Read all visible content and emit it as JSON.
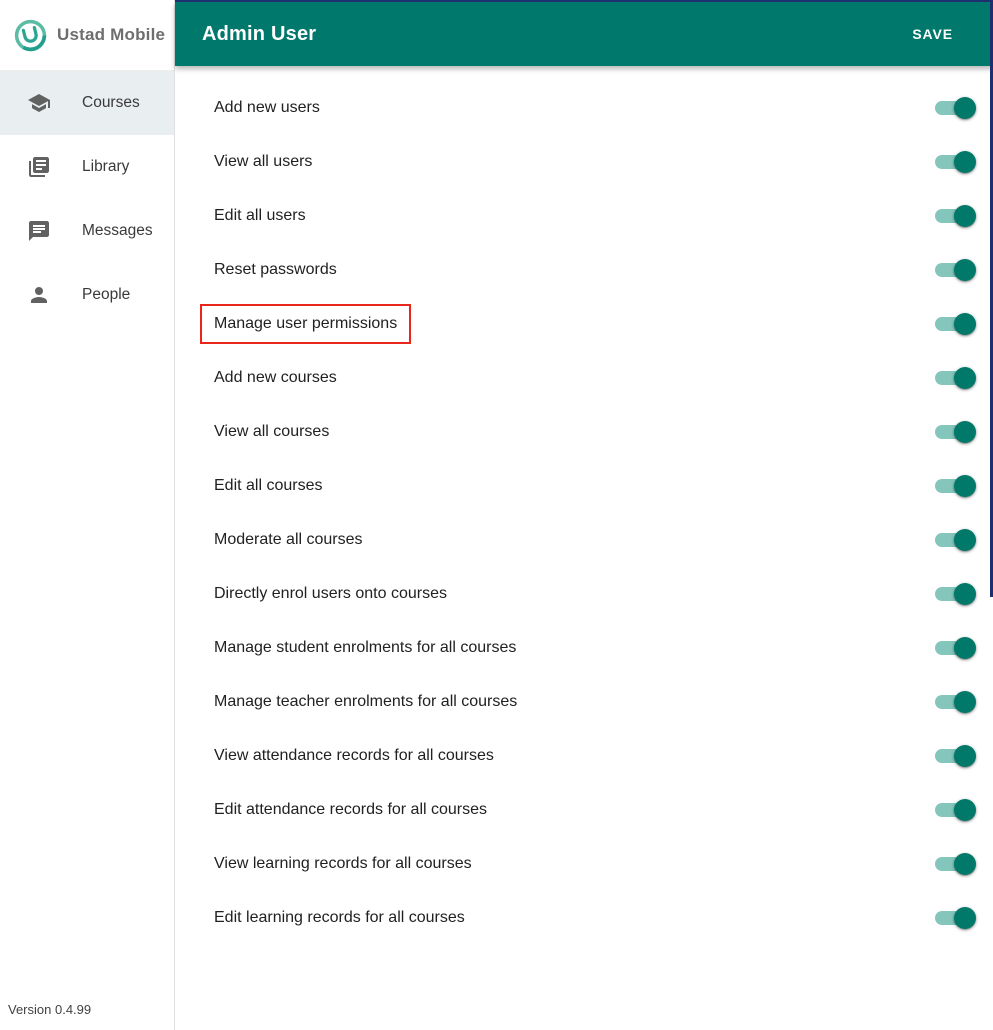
{
  "app": {
    "name": "Ustad Mobile",
    "version_label": "Version 0.4.99"
  },
  "sidebar": {
    "items": [
      {
        "label": "Courses",
        "icon": "school-icon",
        "selected": true
      },
      {
        "label": "Library",
        "icon": "library-books-icon",
        "selected": false
      },
      {
        "label": "Messages",
        "icon": "chat-icon",
        "selected": false
      },
      {
        "label": "People",
        "icon": "person-icon",
        "selected": false
      }
    ]
  },
  "header": {
    "title": "Admin User",
    "save_label": "SAVE"
  },
  "permissions": {
    "items": [
      {
        "label": "Add new users",
        "enabled": true
      },
      {
        "label": "View all users",
        "enabled": true
      },
      {
        "label": "Edit all users",
        "enabled": true
      },
      {
        "label": "Reset passwords",
        "enabled": true
      },
      {
        "label": "Manage user permissions",
        "enabled": true,
        "highlighted": true
      },
      {
        "label": "Add new courses",
        "enabled": true
      },
      {
        "label": "View all courses",
        "enabled": true
      },
      {
        "label": "Edit all courses",
        "enabled": true
      },
      {
        "label": "Moderate all courses",
        "enabled": true
      },
      {
        "label": "Directly enrol users onto courses",
        "enabled": true
      },
      {
        "label": "Manage student enrolments for all courses",
        "enabled": true
      },
      {
        "label": "Manage teacher enrolments for all courses",
        "enabled": true
      },
      {
        "label": "View attendance records for all courses",
        "enabled": true
      },
      {
        "label": "Edit attendance records for all courses",
        "enabled": true
      },
      {
        "label": "View learning records for all courses",
        "enabled": true
      },
      {
        "label": "Edit learning records for all courses",
        "enabled": true
      }
    ]
  },
  "colors": {
    "accent": "#00796B",
    "header_bg": "#00786C",
    "toggle_track": "#84C6BC",
    "highlight_red": "#E8261C",
    "frame_navy": "#1E2F6F",
    "selected_item_bg": "#E9EEF0",
    "icon_gray": "#616161"
  }
}
